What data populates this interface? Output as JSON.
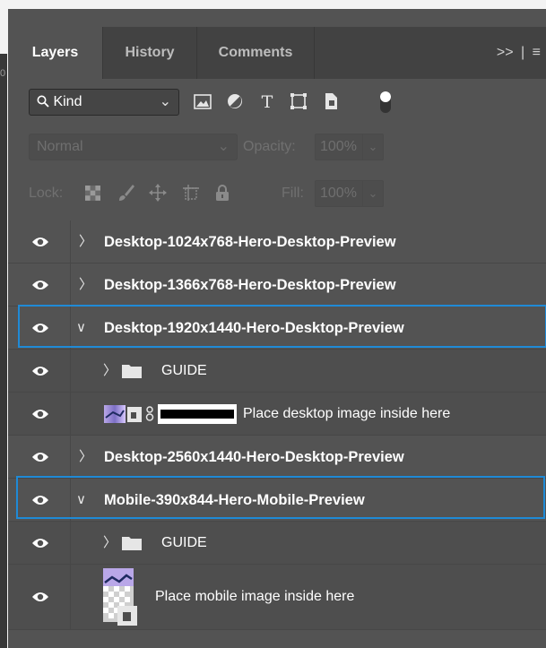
{
  "left_ruler_text": "0",
  "tabs": [
    {
      "label": "Layers",
      "active": true
    },
    {
      "label": "History",
      "active": false
    },
    {
      "label": "Comments",
      "active": false
    }
  ],
  "tab_tools": {
    "expand": ">>",
    "separator": "|",
    "menu": "≡"
  },
  "filter": {
    "kind_label": "Kind",
    "icons": [
      "image-filter-icon",
      "adjustment-filter-icon",
      "type-filter-icon",
      "shape-filter-icon",
      "smart-object-filter-icon",
      "filter-toggle-icon"
    ]
  },
  "blend": {
    "mode": "Normal",
    "opacity_label": "Opacity:",
    "opacity_value": "100%"
  },
  "lock": {
    "label": "Lock:",
    "fill_label": "Fill:",
    "fill_value": "100%"
  },
  "layers": [
    {
      "name": "Desktop-1024x768-Hero-Desktop-Preview",
      "expanded": false,
      "selected": false
    },
    {
      "name": "Desktop-1366x768-Hero-Desktop-Preview",
      "expanded": false,
      "selected": false
    },
    {
      "name": "Desktop-1920x1440-Hero-Desktop-Preview",
      "expanded": true,
      "selected": true
    },
    {
      "name": "GUIDE",
      "type": "folder"
    },
    {
      "name": "Place desktop image inside here",
      "type": "smart-object"
    },
    {
      "name": "Desktop-2560x1440-Hero-Desktop-Preview",
      "expanded": false,
      "selected": false
    },
    {
      "name": "Mobile-390x844-Hero-Mobile-Preview",
      "expanded": true,
      "selected": true
    },
    {
      "name": "GUIDE",
      "type": "folder"
    },
    {
      "name": "Place mobile image inside here",
      "type": "smart-object"
    }
  ],
  "colors": {
    "panel_bg": "#535353",
    "tab_bar_bg": "#424242",
    "selection_outline": "#1f8ad6",
    "text": "#ffffff"
  }
}
